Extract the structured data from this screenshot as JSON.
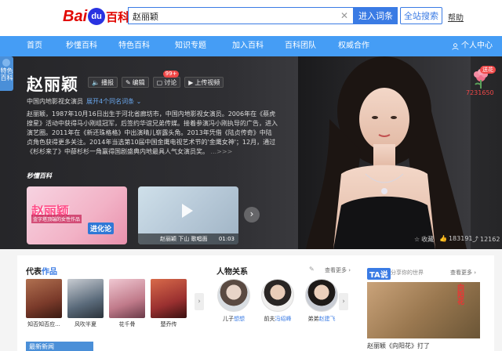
{
  "header": {
    "logo_bai": "Bai",
    "logo_du": "du",
    "logo_baike": "百科",
    "search_value": "赵丽颖",
    "enter_button": "进入词条",
    "full_search_button": "全站搜索",
    "help": "帮助"
  },
  "nav": {
    "items": [
      "首页",
      "秒懂百科",
      "特色百科",
      "知识专题",
      "加入百科",
      "百科团队",
      "权威合作"
    ],
    "personal_center": "个人中心"
  },
  "hero": {
    "side_tab": "特色\n百科",
    "name": "赵丽颖",
    "tools": {
      "play": "播报",
      "edit": "编辑",
      "discuss": "讨论",
      "discuss_badge": "99+",
      "upload": "上传视频"
    },
    "subtitle": "中国内地影视女演员",
    "expand_link": "展开4个同名词条",
    "summary": "赵丽颖，1987年10月16日出生于河北省廊坊市，中国内地影视女演员。2006年在《蔡虎搜星》活动中获得马小刚组冠军，后签约华谊兄弟传媒。接着参演冯小刚执导的广告，进入演艺圈。2011年在《新还珠格格》中出演晴儿崭露头角。2013年凭借《陆贞传奇》中陆贞角色获得更多关注。2014年当选第10届中国金鹰电视艺术节的'金鹰女神'；12月，通过《杉杉来了》中薛杉杉一角赢得国剧盛典内地最具人气女演员奖。",
    "summary_more": "...>>>",
    "video_brand": "秒懂百科",
    "videos": [
      {
        "title": "赵丽颖",
        "sub": "金字塔顶端的女性作品",
        "tag": "进化论"
      },
      {
        "caption": "赵丽颖 下山 歌唱面",
        "time": "01:03"
      }
    ],
    "stats": {
      "favorite": "收藏",
      "likes": "183191",
      "shares": "12162"
    },
    "flower_tag": "送花",
    "flower_count": "7231650"
  },
  "works": {
    "title_a": "代表",
    "title_b": "作品",
    "items": [
      {
        "name": "知否知否应...",
        "color": "#7a3a2a"
      },
      {
        "name": "风吹半夏",
        "color": "#5a6a7a"
      },
      {
        "name": "花千骨",
        "color": "#c07a8a"
      },
      {
        "name": "楚乔传",
        "color": "#9a3030"
      }
    ]
  },
  "relations": {
    "title": "人物关系",
    "see_more": "查看更多",
    "items": [
      {
        "role": "儿子",
        "name": "想想"
      },
      {
        "role": "前夫",
        "name": "冯绍峰"
      },
      {
        "role": "弟弟",
        "name": "赵建飞"
      }
    ]
  },
  "ta_panel": {
    "logo": "TA说",
    "slogan": "分享你的世界",
    "see_more": "查看更多",
    "poster_title": "向阳花",
    "caption": "赵丽颖《向阳花》打了"
  },
  "news_tab": "最新新闻"
}
